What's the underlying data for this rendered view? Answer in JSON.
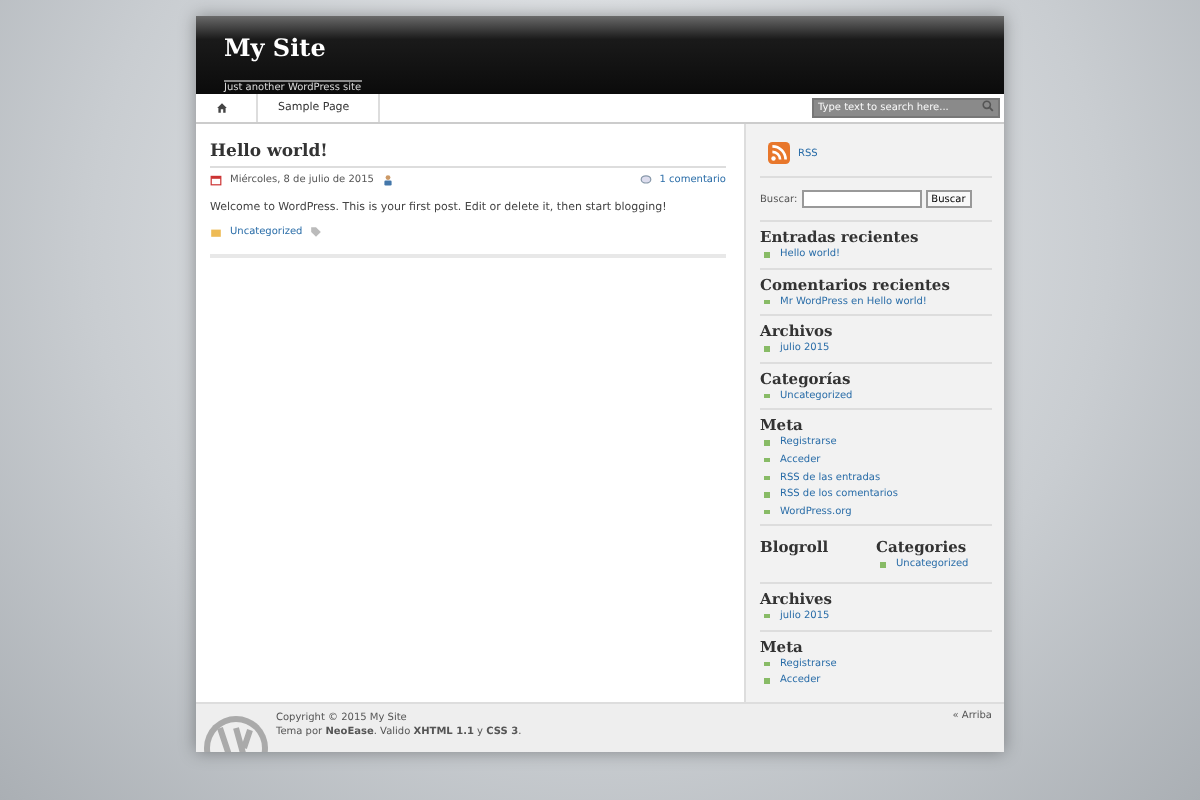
{
  "header": {
    "title": "My Site",
    "tagline": "Just another WordPress site"
  },
  "nav": {
    "items": [
      {
        "label": "Sample Page",
        "selected": false
      }
    ],
    "search": {
      "placeholder": "Type text to search here..."
    }
  },
  "post": {
    "title": "Hello world!",
    "date": "Miércoles, 8 de julio de 2015",
    "comments": "1 comentario",
    "body": "Welcome to WordPress. This is your first post. Edit or delete it, then start blogging!",
    "category": "Uncategorized"
  },
  "sidebar": {
    "rss": "RSS",
    "search": {
      "label": "Buscar:",
      "button": "Buscar"
    },
    "widgets": [
      {
        "title": "Entradas recientes",
        "items": [
          "Hello world!"
        ]
      },
      {
        "title": "Comentarios recientes",
        "items": [
          "Mr WordPress en Hello world!"
        ]
      },
      {
        "title": "Archivos",
        "items": [
          "julio 2015"
        ]
      },
      {
        "title": "Categorías",
        "items": [
          "Uncategorized"
        ]
      },
      {
        "title": "Meta",
        "items": [
          "Registrarse",
          "Acceder",
          "RSS de las entradas",
          "RSS de los comentarios",
          "WordPress.org"
        ]
      }
    ],
    "columns": [
      {
        "title": "Blogroll"
      },
      {
        "title": "Categories",
        "items": [
          "Uncategorized"
        ]
      }
    ],
    "bottom_widgets": [
      {
        "title": "Archives",
        "items": [
          "julio 2015"
        ]
      },
      {
        "title": "Meta",
        "items": [
          "Registrarse",
          "Acceder"
        ]
      }
    ]
  },
  "footer": {
    "copyright": "Copyright © 2015 My Site",
    "credits": "Tema por **NeoEase**. Valido **XHTML 1.1** y **CSS 3**.",
    "top_link": "« Arriba"
  }
}
